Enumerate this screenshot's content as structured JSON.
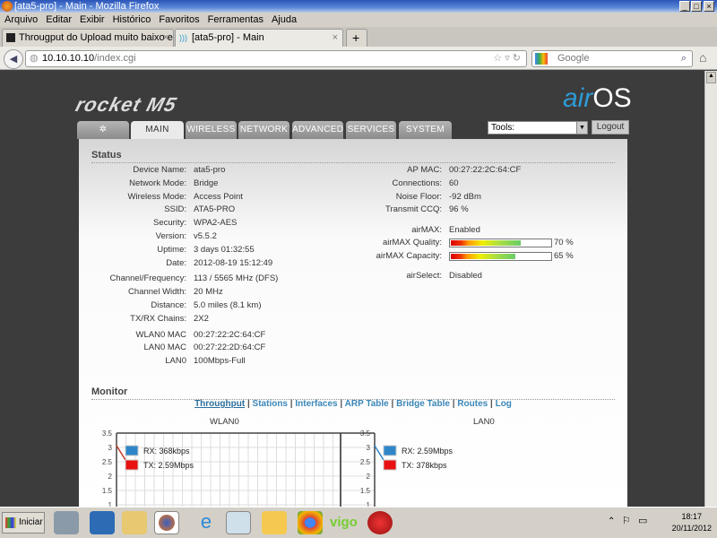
{
  "window": {
    "title": "[ata5-pro] - Main - Mozilla Firefox"
  },
  "menu": [
    "Arquivo",
    "Editar",
    "Exibir",
    "Histórico",
    "Favoritos",
    "Ferramentas",
    "Ajuda"
  ],
  "tabs": [
    {
      "label": "Througput do Upload muito baixo em equ..."
    },
    {
      "label": "[ata5-pro] - Main"
    }
  ],
  "nav": {
    "url_host": "10.10.10.10",
    "url_path": "/index.cgi",
    "search_placeholder": "Google"
  },
  "brand": {
    "logo": "rocket M5",
    "airos_air": "air",
    "airos_os": "OS"
  },
  "nav_tabs": [
    "MAIN",
    "WIRELESS",
    "NETWORK",
    "ADVANCED",
    "SERVICES",
    "SYSTEM"
  ],
  "tools": {
    "label": "Tools:",
    "logout": "Logout"
  },
  "status": {
    "title": "Status",
    "left": [
      [
        "Device Name:",
        "ata5-pro"
      ],
      [
        "Network Mode:",
        "Bridge"
      ],
      [
        "Wireless Mode:",
        "Access Point"
      ],
      [
        "SSID:",
        "ATA5-PRO"
      ],
      [
        "Security:",
        "WPA2-AES"
      ],
      [
        "Version:",
        "v5.5.2"
      ],
      [
        "Uptime:",
        "3 days 01:32:55"
      ],
      [
        "Date:",
        "2012-08-19 15:12:49"
      ],
      [
        "Channel/Frequency:",
        "113 / 5565 MHz (DFS)"
      ],
      [
        "Channel Width:",
        "20 MHz"
      ],
      [
        "Distance:",
        "5.0 miles (8.1 km)"
      ],
      [
        "TX/RX Chains:",
        "2X2"
      ],
      [
        "WLAN0 MAC",
        "00:27:22:2C:64:CF"
      ],
      [
        "LAN0 MAC",
        "00:27:22:2D:64:CF"
      ],
      [
        "LAN0",
        "100Mbps-Full"
      ]
    ],
    "right": [
      [
        "AP MAC:",
        "00:27:22:2C:64:CF"
      ],
      [
        "Connections:",
        "60"
      ],
      [
        "Noise Floor:",
        "-92 dBm"
      ],
      [
        "Transmit CCQ:",
        "96 %"
      ],
      [
        "airMAX:",
        "Enabled"
      ],
      [
        "airMAX Quality:",
        "70 %"
      ],
      [
        "airMAX Capacity:",
        "65 %"
      ],
      [
        "airSelect:",
        "Disabled"
      ]
    ],
    "airmax_quality": 0.7,
    "airmax_capacity": 0.65
  },
  "monitor": {
    "title": "Monitor",
    "links": [
      "Throughput",
      "Stations",
      "Interfaces",
      "ARP Table",
      "Bridge Table",
      "Routes",
      "Log"
    ],
    "sep": "|"
  },
  "chart_data": [
    {
      "type": "line",
      "title": "WLAN0",
      "yticks": [
        "3.5",
        "3",
        "2.5",
        "2",
        "1.5",
        "1"
      ],
      "ylim": [
        1,
        3.5
      ],
      "legend": [
        {
          "label": "RX: 368kbps",
          "color": "#2e86c8"
        },
        {
          "label": "TX: 2.59Mbps",
          "color": "#e81010"
        }
      ]
    },
    {
      "type": "line",
      "title": "LAN0",
      "yticks": [
        "3.5",
        "3",
        "2.5",
        "2",
        "1.5",
        "1"
      ],
      "ylim": [
        1,
        3.5
      ],
      "legend": [
        {
          "label": "RX: 2.59Mbps",
          "color": "#2e86c8"
        },
        {
          "label": "TX: 378kbps",
          "color": "#e81010"
        }
      ]
    }
  ],
  "taskbar": {
    "start": "Iniciar",
    "time": "18:17",
    "date": "20/11/2012",
    "vigo": "vigo"
  }
}
